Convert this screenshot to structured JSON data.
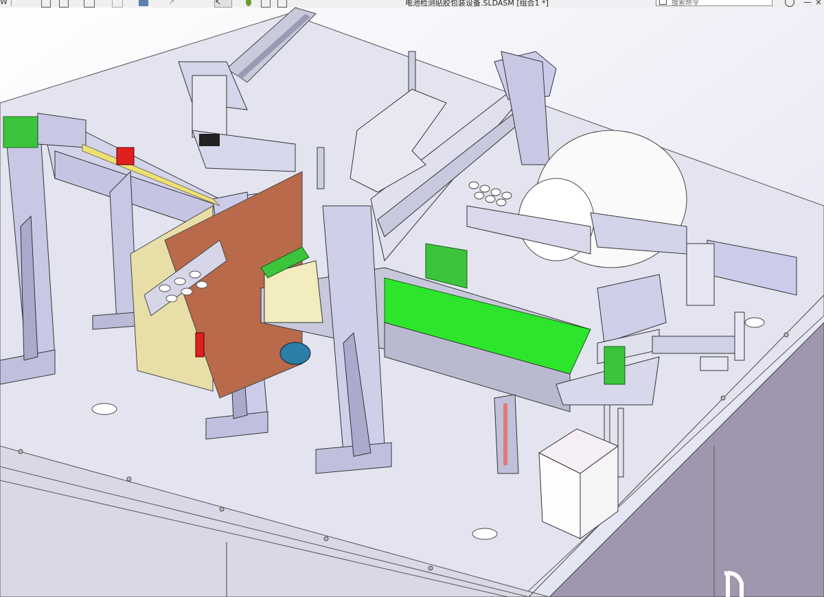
{
  "window": {
    "title": "~电池检测贴胶包装设备.SLDASM [组合1 *]",
    "title_visible": "电池检测贴胶包装设备.SLDASM [组合1 *]",
    "search_placeholder": "搜索命令",
    "help_icon": "help-icon",
    "controls": [
      "minimize-icon",
      "close-icon"
    ]
  },
  "heads_up_toolbar": {
    "icons": [
      "zoom-to-fit-icon",
      "zoom-area-icon",
      "previous-view-icon",
      "section-view-icon",
      "dynamic-annotation-icon",
      "view-orientation-icon",
      "display-style-icon",
      "hide-show-items-icon",
      "edit-appearance-icon",
      "apply-scene-icon",
      "view-settings-icon"
    ]
  },
  "colors": {
    "frame": "#c9c9e6",
    "conveyor_belt": "#2ee52e",
    "motor_green": "#3fc83f",
    "wood": "#b86a4b",
    "panel_cream": "#f2ecbe",
    "red_part": "#e02020",
    "blue_motor": "#2b7ea8"
  }
}
